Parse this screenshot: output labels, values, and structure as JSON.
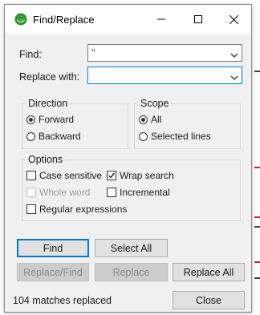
{
  "window": {
    "title": "Find/Replace"
  },
  "find": {
    "label": "Find:",
    "value": "''"
  },
  "replace": {
    "label": "Replace with:",
    "value": ""
  },
  "direction": {
    "title": "Direction",
    "options": [
      {
        "label": "Forward",
        "selected": true
      },
      {
        "label": "Backward",
        "selected": false
      }
    ]
  },
  "scope": {
    "title": "Scope",
    "options": [
      {
        "label": "All",
        "selected": true
      },
      {
        "label": "Selected lines",
        "selected": false
      }
    ]
  },
  "options": {
    "title": "Options",
    "case_sensitive": {
      "label": "Case sensitive",
      "checked": false
    },
    "wrap_search": {
      "label": "Wrap search",
      "checked": true
    },
    "whole_word": {
      "label": "Whole word",
      "checked": false,
      "enabled": false
    },
    "incremental": {
      "label": "Incremental",
      "checked": false
    },
    "regex": {
      "label": "Regular expressions",
      "checked": false
    }
  },
  "buttons": {
    "find": "Find",
    "select_all": "Select All",
    "replace_find": "Replace/Find",
    "replace": "Replace",
    "replace_all": "Replace All",
    "close": "Close"
  },
  "status": "104 matches replaced",
  "colors": {
    "accent": "#0078d7",
    "dialog_bg": "#f0f0f0",
    "disabled_button": "#cccccc"
  }
}
